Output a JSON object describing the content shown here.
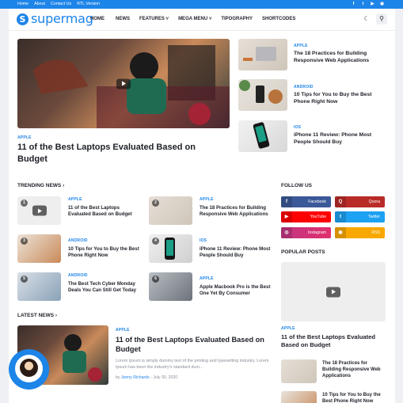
{
  "topbar": {
    "links": [
      "Home",
      "About",
      "Contact Us",
      "RTL Version"
    ],
    "social_icons": [
      "facebook-icon",
      "twitter-icon",
      "youtube-icon",
      "rss-icon"
    ]
  },
  "header": {
    "logo_text": "supermag",
    "logo_mark": "S",
    "nav": [
      "HOME",
      "NEWS",
      "FEATURES ˅",
      "MEGA MENU ˅",
      "TIPOGRAPHY",
      "SHORTCODES"
    ],
    "icons": [
      "moon-icon",
      "search-icon"
    ]
  },
  "hero": {
    "category": "APPLE",
    "title": "11 of the Best Laptops Evaluated Based on Budget"
  },
  "hero_side": [
    {
      "category": "APPLE",
      "title": "The 18 Practices for Building Responsive Web Applications"
    },
    {
      "category": "ANDROID",
      "title": "10 Tips for You to Buy the Best Phone Right Now"
    },
    {
      "category": "IOS",
      "title": "iPhone 11 Review: Phone Most People Should Buy"
    }
  ],
  "trending": {
    "heading": "TRENDING NEWS",
    "items": [
      {
        "num": "1",
        "category": "APPLE",
        "title": "11 of the Best Laptops Evaluated Based on Budget"
      },
      {
        "num": "2",
        "category": "APPLE",
        "title": "The 18 Practices for Building Responsive Web Applications"
      },
      {
        "num": "3",
        "category": "ANDROID",
        "title": "10 Tips for You to Buy the Best Phone Right Now"
      },
      {
        "num": "4",
        "category": "IOS",
        "title": "iPhone 11 Review: Phone Most People Should Buy"
      },
      {
        "num": "5",
        "category": "ANDROID",
        "title": "The Best Tech Cyber Monday Deals You Can Still Get Today"
      },
      {
        "num": "6",
        "category": "APPLE",
        "title": "Apple Macbook Pro is the Best One Yet By Consumer"
      }
    ]
  },
  "follow": {
    "heading": "FOLLOW US",
    "buttons": [
      {
        "label": "Facebook",
        "icon": "f",
        "color": "#3b5998"
      },
      {
        "label": "Quora",
        "icon": "Q",
        "color": "#b92b27"
      },
      {
        "label": "YouTube",
        "icon": "▶",
        "color": "#ff0000"
      },
      {
        "label": "Twitter",
        "icon": "t",
        "color": "#1da1f2"
      },
      {
        "label": "Instagram",
        "icon": "◎",
        "color": "#c13584"
      },
      {
        "label": "RSS",
        "icon": "◉",
        "color": "#f9a800"
      }
    ]
  },
  "popular": {
    "heading": "POPULAR POSTS",
    "main": {
      "category": "APPLE",
      "title": "11 of the Best Laptops Evaluated Based on Budget"
    },
    "items": [
      {
        "title": "The 18 Practices for Building Responsive Web Applications"
      },
      {
        "title": "10 Tips for You to Buy the Best Phone Right Now"
      }
    ]
  },
  "latest": {
    "heading": "LATEST NEWS",
    "post": {
      "category": "APPLE",
      "title": "11 of the Best Laptops Evaluated Based on Budget",
      "excerpt": "Lorem Ipsum is simply dummy text of the printing and typesetting industry. Lorem Ipsum has been the industry's standard dum...",
      "by": "by",
      "author": "Jonny Richards",
      "date": "- July 30, 2020"
    }
  },
  "colors": {
    "accent": "#1d84e8",
    "topbar": "#1d84e8"
  }
}
